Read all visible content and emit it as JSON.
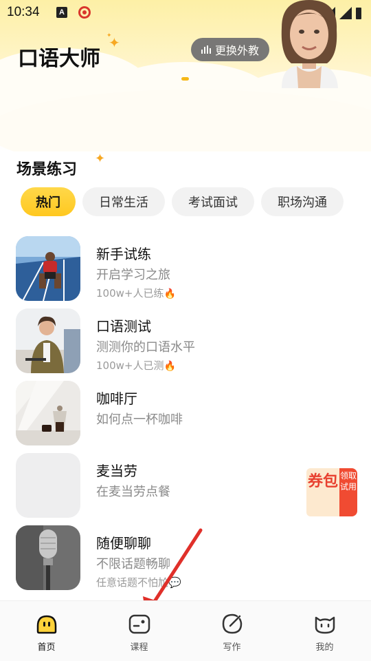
{
  "status_bar": {
    "time": "10:34",
    "icon_a": "A"
  },
  "header": {
    "title": "口语大师",
    "switch_button_label": "更换外教"
  },
  "section": {
    "title": "场景练习"
  },
  "tabs": [
    {
      "label": "热门",
      "active": true
    },
    {
      "label": "日常生活",
      "active": false
    },
    {
      "label": "考试面试",
      "active": false
    },
    {
      "label": "职场沟通",
      "active": false
    }
  ],
  "scenes": [
    {
      "title": "新手试练",
      "subtitle": "开启学习之旅",
      "meta": "100w+人已练"
    },
    {
      "title": "口语测试",
      "subtitle": "测测你的口语水平",
      "meta": "100w+人已测"
    },
    {
      "title": "咖啡厅",
      "subtitle": "如何点一杯咖啡",
      "meta": ""
    },
    {
      "title": "麦当劳",
      "subtitle": "在麦当劳点餐",
      "meta": ""
    },
    {
      "title": "随便聊聊",
      "subtitle": "不限话题畅聊",
      "meta": "任意话题不怕尬"
    }
  ],
  "coupon": {
    "left_text": "券包",
    "right_text": "领取试用"
  },
  "bottom_nav": [
    {
      "label": "首页",
      "icon": "home-face-icon",
      "active": true
    },
    {
      "label": "课程",
      "icon": "course-icon",
      "active": false
    },
    {
      "label": "写作",
      "icon": "writing-icon",
      "active": false
    },
    {
      "label": "我的",
      "icon": "cat-profile-icon",
      "active": false
    }
  ],
  "colors": {
    "accent_yellow": "#ffd23a",
    "header_bg": "#fdf0a6",
    "coupon_red": "#f04b32",
    "arrow_red": "#e0302a"
  }
}
